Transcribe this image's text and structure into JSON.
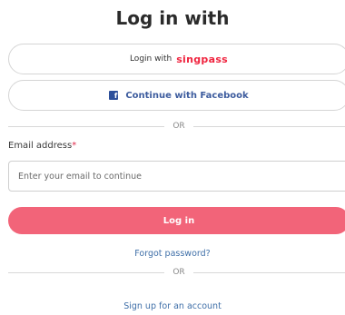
{
  "title": "Log in with",
  "singpass": {
    "prefix": "Login with",
    "logo_text": "singpass",
    "logo_color": "#f0243f"
  },
  "facebook": {
    "label": "Continue with Facebook",
    "icon": "facebook-icon",
    "color": "#3d5c9e"
  },
  "divider_text": "OR",
  "email": {
    "label": "Email address",
    "required_mark": "*",
    "placeholder": "Enter your email to continue",
    "value": ""
  },
  "login_button": {
    "label": "Log in",
    "color": "#f26479"
  },
  "forgot_link": "Forgot password?",
  "signup_link": "Sign up for an account"
}
